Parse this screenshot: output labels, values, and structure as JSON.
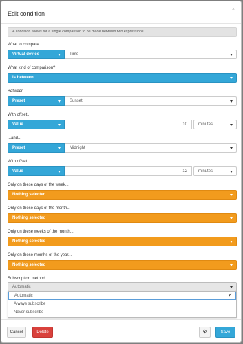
{
  "dialog": {
    "title": "Edit condition",
    "close_glyph": "×",
    "info": "A condition allows for a single comparison to be made between two expressions."
  },
  "compare": {
    "label": "What to compare",
    "type": "Virtual device",
    "value": "Time"
  },
  "comparison": {
    "label": "What kind of comparison?",
    "value": "is between"
  },
  "between": {
    "label": "Between...",
    "type": "Preset",
    "value": "Sunset"
  },
  "offset1": {
    "label": "With offset...",
    "type": "Value",
    "amount": "10",
    "unit": "minutes"
  },
  "and": {
    "label": "...and...",
    "type": "Preset",
    "value": "Midnight"
  },
  "offset2": {
    "label": "With offset...",
    "type": "Value",
    "amount": "12",
    "unit": "minutes"
  },
  "days_week": {
    "label": "Only on these days of the week...",
    "value": "Nothing selected"
  },
  "days_month": {
    "label": "Only on these days of the month...",
    "value": "Nothing selected"
  },
  "weeks_month": {
    "label": "Only on these weeks of the month...",
    "value": "Nothing selected"
  },
  "months_year": {
    "label": "Only on these months of the year...",
    "value": "Nothing selected"
  },
  "subscription": {
    "label": "Subscription method",
    "value": "Automatic",
    "options": [
      "Automatic",
      "Always subscribe",
      "Never subscribe"
    ],
    "check_glyph": "✔"
  },
  "footer": {
    "cancel": "Cancel",
    "delete": "Delete",
    "gear_glyph": "⚙",
    "save": "Save"
  },
  "colors": {
    "primary_blue": "#34a7d8",
    "warning_orange": "#f29b1d",
    "danger_red": "#d9413c"
  }
}
